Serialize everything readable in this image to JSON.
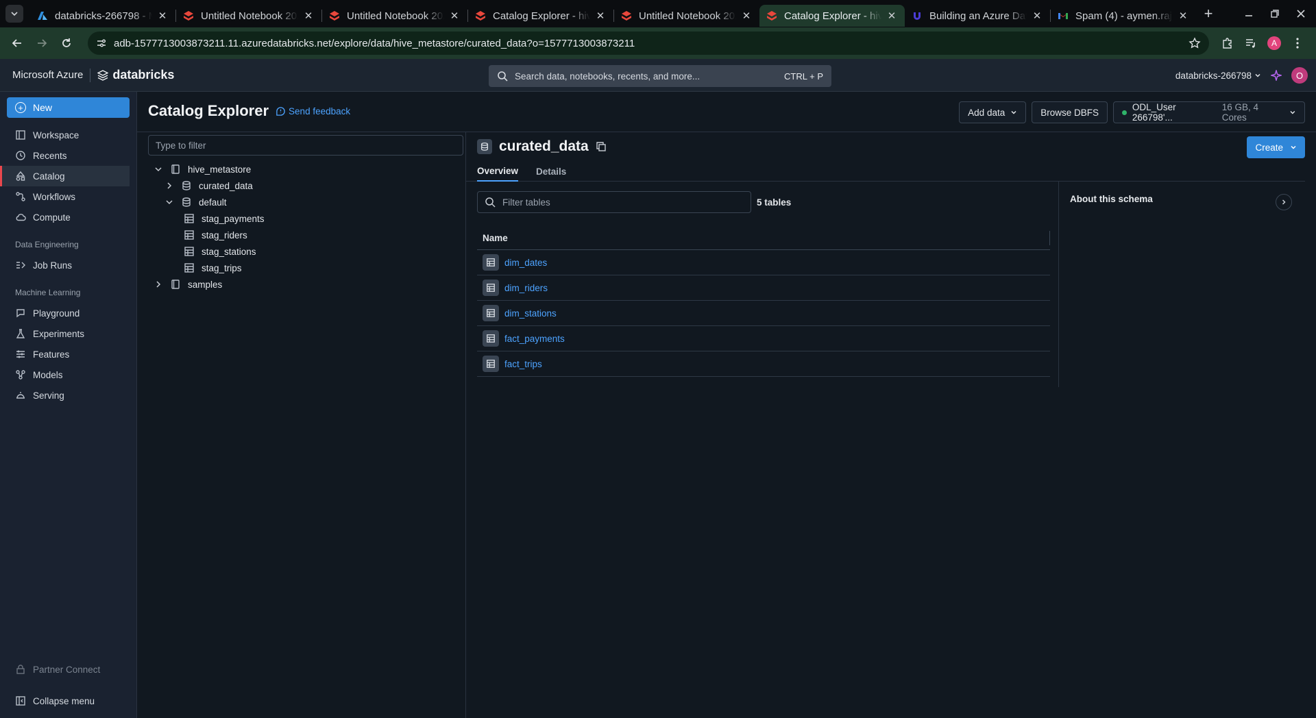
{
  "browser": {
    "tabs": [
      {
        "title": "databricks-266798 - Microsoft Azure",
        "icon": "azure-icon"
      },
      {
        "title": "Untitled Notebook 2024-",
        "icon": "databricks-icon"
      },
      {
        "title": "Untitled Notebook 2024-",
        "icon": "databricks-icon"
      },
      {
        "title": "Catalog Explorer - hive_metastore",
        "icon": "databricks-icon"
      },
      {
        "title": "Untitled Notebook 2024-",
        "icon": "databricks-icon"
      },
      {
        "title": "Catalog Explorer - hive_metastore",
        "icon": "databricks-icon",
        "active": true
      },
      {
        "title": "Building an Azure Data",
        "icon": "udemy-icon"
      },
      {
        "title": "Spam (4) - aymen.rajab",
        "icon": "gmail-icon"
      }
    ],
    "url": "adb-1577713003873211.11.azuredatabricks.net/explore/data/hive_metastore/curated_data?o=1577713003873211",
    "profile_initial": "A",
    "accent_color": "#1f3a2c"
  },
  "header": {
    "ms_brand": "Microsoft Azure",
    "db_brand": "databricks",
    "search_placeholder": "Search data, notebooks, recents, and more...",
    "search_shortcut": "CTRL + P",
    "workspace": "databricks-266798",
    "user_initial": "O"
  },
  "sidebar": {
    "new_label": "New",
    "items": [
      {
        "label": "Workspace",
        "icon": "workspace-icon"
      },
      {
        "label": "Recents",
        "icon": "clock-icon"
      },
      {
        "label": "Catalog",
        "icon": "catalog-icon",
        "active": true
      },
      {
        "label": "Workflows",
        "icon": "workflows-icon"
      },
      {
        "label": "Compute",
        "icon": "cloud-icon"
      }
    ],
    "section_data_eng": "Data Engineering",
    "data_eng_items": [
      {
        "label": "Job Runs",
        "icon": "job-runs-icon"
      }
    ],
    "section_ml": "Machine Learning",
    "ml_items": [
      {
        "label": "Playground",
        "icon": "playground-icon"
      },
      {
        "label": "Experiments",
        "icon": "experiments-icon"
      },
      {
        "label": "Features",
        "icon": "features-icon"
      },
      {
        "label": "Models",
        "icon": "models-icon"
      },
      {
        "label": "Serving",
        "icon": "serving-icon"
      }
    ],
    "partner_connect": "Partner Connect",
    "collapse_menu": "Collapse menu"
  },
  "page": {
    "title": "Catalog Explorer",
    "feedback": "Send feedback",
    "add_data": "Add data",
    "browse_dbfs": "Browse DBFS",
    "cluster_name": "ODL_User 266798'...",
    "cluster_meta": "16 GB, 4 Cores",
    "cluster_status_color": "#2fb36a"
  },
  "tree": {
    "filter_placeholder": "Type to filter",
    "root": "hive_metastore",
    "schema_curated": "curated_data",
    "schema_default": "default",
    "default_tables": [
      "stag_payments",
      "stag_riders",
      "stag_stations",
      "stag_trips"
    ],
    "samples": "samples"
  },
  "schema": {
    "name": "curated_data",
    "create_label": "Create",
    "tabs": [
      "Overview",
      "Details"
    ],
    "filter_placeholder": "Filter tables",
    "count_label": "5 tables",
    "column_name": "Name",
    "tables": [
      "dim_dates",
      "dim_riders",
      "dim_stations",
      "fact_payments",
      "fact_trips"
    ],
    "about_title": "About this schema"
  }
}
